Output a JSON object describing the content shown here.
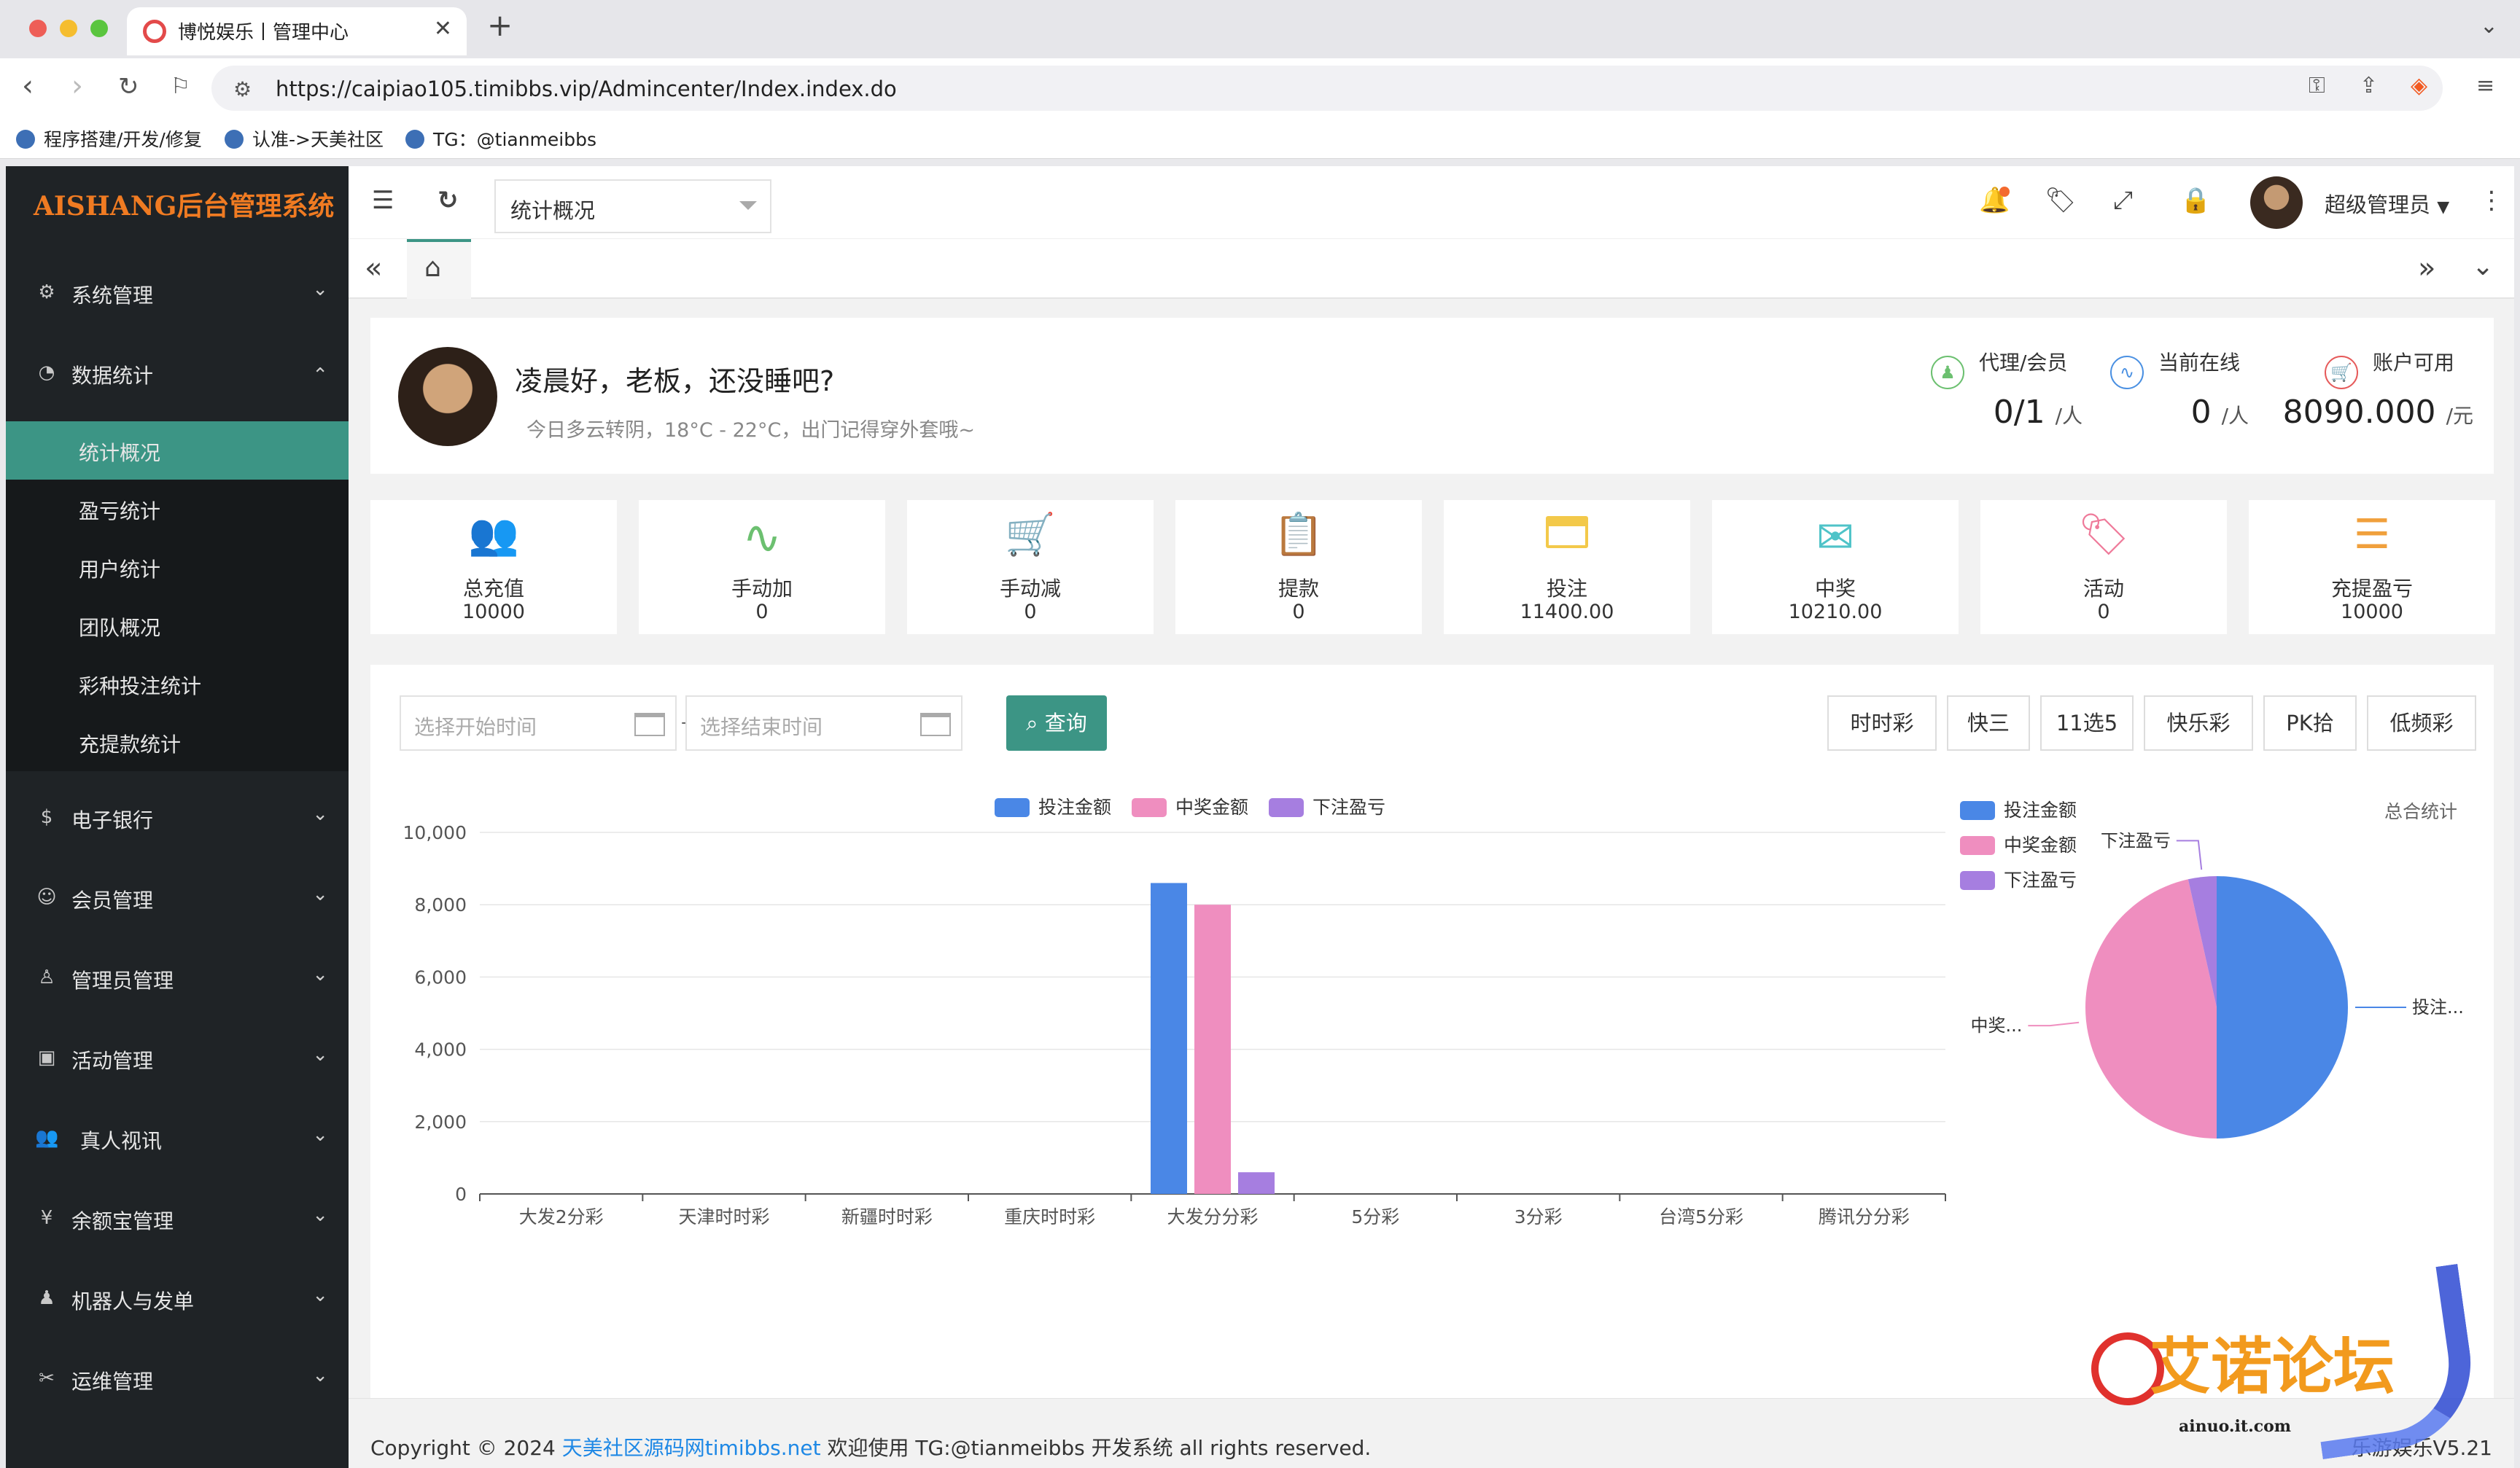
{
  "browser": {
    "tab_title": "博悦娱乐丨管理中心",
    "url": "https://caipiao105.timibbs.vip/Admincenter/Index.index.do",
    "bookmarks": [
      "程序搭建/开发/修复",
      "认准->天美社区",
      "TG：@tianmeibbs"
    ]
  },
  "sidebar": {
    "logo": "AISHANG后台管理系统",
    "items": [
      {
        "label": "系统管理",
        "icon": "gear-icon"
      },
      {
        "label": "数据统计",
        "icon": "dashboard-icon"
      },
      {
        "label": "电子银行",
        "icon": "dollar-icon"
      },
      {
        "label": "会员管理",
        "icon": "users-icon"
      },
      {
        "label": "管理员管理",
        "icon": "user-icon"
      },
      {
        "label": "活动管理",
        "icon": "gift-icon"
      },
      {
        "label": "真人视讯",
        "icon": "group-icon"
      },
      {
        "label": "余额宝管理",
        "icon": "yen-icon"
      },
      {
        "label": "机器人与发单",
        "icon": "person-icon"
      },
      {
        "label": "运维管理",
        "icon": "tools-icon"
      }
    ],
    "sub_items": [
      "统计概况",
      "盈亏统计",
      "用户统计",
      "团队概况",
      "彩种投注统计",
      "充提款统计"
    ]
  },
  "topbar": {
    "page_select": "统计概况",
    "user_name": "超级管理员"
  },
  "welcome": {
    "greeting": "凌晨好，老板，还没睡吧?",
    "weather": "今日多云转阴，18°C - 22°C，出门记得穿外套哦~",
    "stats": [
      {
        "label": "代理/会员",
        "value": "0/1",
        "unit": "/人",
        "color": "#6cc070",
        "icon": "agent-icon"
      },
      {
        "label": "当前在线",
        "value": "0",
        "unit": "/人",
        "color": "#4a90e2",
        "icon": "pulse-icon"
      },
      {
        "label": "账户可用",
        "value": "8090.000",
        "unit": "/元",
        "color": "#e65a5a",
        "icon": "cart-icon"
      }
    ]
  },
  "kpis": [
    {
      "label": "总充值",
      "value": "10000",
      "icon": "users-icon",
      "glyph": "👥",
      "color": "#5b9bd5"
    },
    {
      "label": "手动加",
      "value": "0",
      "icon": "pulse-icon",
      "glyph": "∿",
      "color": "#6cc070"
    },
    {
      "label": "手动减",
      "value": "0",
      "icon": "cart-icon",
      "glyph": "🛒",
      "color": "#f08a5d"
    },
    {
      "label": "提款",
      "value": "0",
      "icon": "clipboard-icon",
      "glyph": "📋",
      "color": "#9b7fd1"
    },
    {
      "label": "投注",
      "value": "11400.00",
      "icon": "card-icon",
      "glyph": "▬",
      "color": "#f3c94a"
    },
    {
      "label": "中奖",
      "value": "10210.00",
      "icon": "mail-icon",
      "glyph": "✉",
      "color": "#4fc3c8"
    },
    {
      "label": "活动",
      "value": "0",
      "icon": "tag-icon",
      "glyph": "🏷",
      "color": "#ef7a9a"
    },
    {
      "label": "充提盈亏",
      "value": "10000",
      "icon": "sliders-icon",
      "glyph": "☰",
      "color": "#f0a03c"
    }
  ],
  "filters": {
    "start_placeholder": "选择开始时间",
    "end_placeholder": "选择结束时间",
    "query_label": "查询",
    "types": [
      "时时彩",
      "快三",
      "11选5",
      "快乐彩",
      "PK拾",
      "低频彩"
    ]
  },
  "colors": {
    "accent": "#3c9585",
    "bet": "#4a87e6",
    "win": "#ef8ebf",
    "profit": "#a67ee0"
  },
  "chart_data": [
    {
      "type": "bar",
      "categories": [
        "大发2分彩",
        "天津时时彩",
        "新疆时时彩",
        "重庆时时彩",
        "大发分分彩",
        "5分彩",
        "3分彩",
        "台湾5分彩",
        "腾讯分分彩"
      ],
      "series": [
        {
          "name": "投注金额",
          "values": [
            0,
            0,
            0,
            0,
            8600,
            0,
            0,
            0,
            0
          ]
        },
        {
          "name": "中奖金额",
          "values": [
            0,
            0,
            0,
            0,
            8000,
            0,
            0,
            0,
            0
          ]
        },
        {
          "name": "下注盈亏",
          "values": [
            0,
            0,
            0,
            0,
            600,
            0,
            0,
            0,
            0
          ]
        }
      ],
      "yticks": [
        "0",
        "2,000",
        "4,000",
        "6,000",
        "8,000",
        "10,000"
      ],
      "ylim": [
        0,
        10000
      ],
      "legend": "top-center"
    },
    {
      "type": "pie",
      "title": "总合统计",
      "labels": [
        "投注...",
        "中奖...",
        "下注盈亏"
      ],
      "legend_labels": [
        "投注金额",
        "中奖金额",
        "下注盈亏"
      ],
      "values": [
        8600,
        8000,
        600
      ],
      "legend": "top-left"
    }
  ],
  "footer": {
    "prefix": "Copyright © 2024 ",
    "link": "天美社区源码网timibbs.net",
    "suffix": " 欢迎使用 TG:@tianmeibbs 开发系统 all rights reserved.",
    "version": "乐游娱乐V5.21"
  },
  "watermark": {
    "text": "艾诺论坛",
    "sub": "ainuo.it.com"
  }
}
